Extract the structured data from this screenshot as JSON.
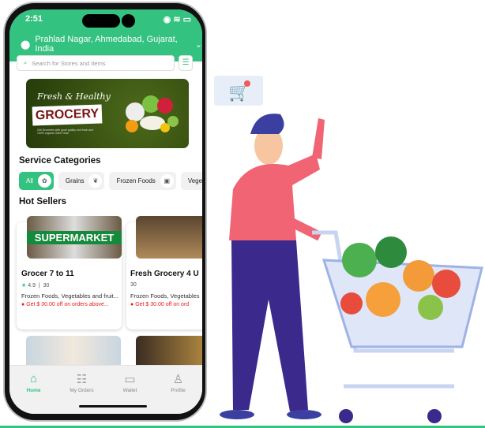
{
  "status": {
    "time": "2:51"
  },
  "location": {
    "text": "Prahlad Nagar, Ahmedabad, Gujarat, India"
  },
  "search": {
    "placeholder": "Search for Stores and Items"
  },
  "banner": {
    "line1": "Fresh & Healthy",
    "line2": "GROCERY",
    "sub": "Get Groceries with good quality and fresh and 100% organic Order Now!"
  },
  "sections": {
    "categories": "Service Categories",
    "hot": "Hot Sellers"
  },
  "categories": [
    {
      "label": "All",
      "icon": "basket-icon"
    },
    {
      "label": "Grains",
      "icon": "grain-icon"
    },
    {
      "label": "Frozen Foods",
      "icon": "frozen-icon"
    },
    {
      "label": "Vegetab",
      "icon": "vegetable-icon"
    }
  ],
  "stores": [
    {
      "name": "Grocer 7 to 11",
      "rating": "4.9",
      "time": "30",
      "desc": "Frozen Foods, Vegetables and fruit...",
      "offer": "Get $ 30.00 off on orders above...",
      "banner_text": "SUPERMARKET"
    },
    {
      "name": "Fresh Grocery 4 U",
      "time": "30",
      "desc": "Frozen Foods, Vegetables",
      "offer": "Get $ 30.00 off on ord"
    }
  ],
  "nav": [
    {
      "label": "Home",
      "icon": "home-icon",
      "active": true
    },
    {
      "label": "My Orders",
      "icon": "orders-icon"
    },
    {
      "label": "Wallet",
      "icon": "wallet-icon"
    },
    {
      "label": "Profile",
      "icon": "profile-icon"
    }
  ],
  "colors": {
    "primary": "#33c27f",
    "offer": "#e41b1b"
  }
}
